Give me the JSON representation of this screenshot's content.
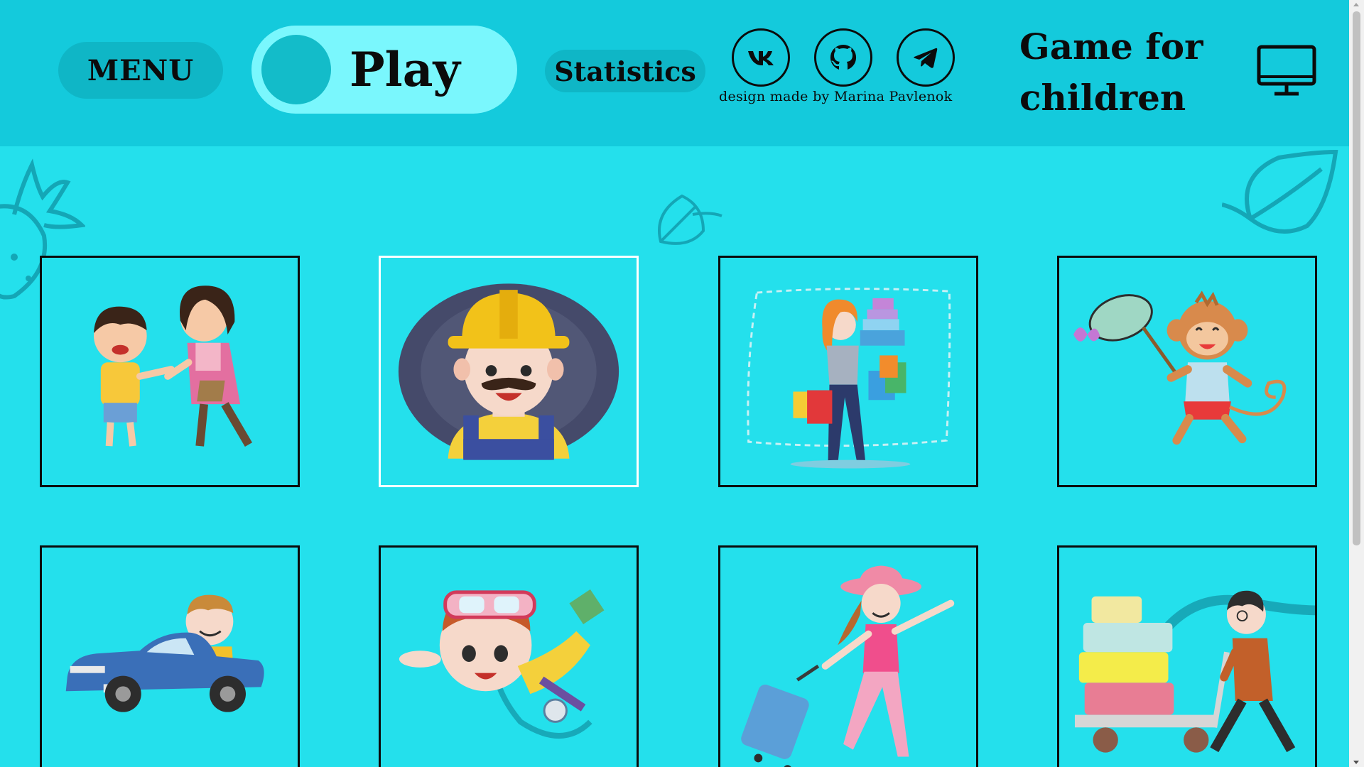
{
  "header": {
    "menu_label": "MENU",
    "play_label": "Play",
    "statistics_label": "Statistics",
    "credit": "design made by Marina Pavlenok",
    "title": "Game for children",
    "social_links": [
      "vk-icon",
      "github-icon",
      "telegram-icon"
    ]
  },
  "colors": {
    "background": "#24e0ec",
    "header": "#14cadc",
    "toggle": "#7af7fd",
    "button": "#0fb6c6",
    "active_border": "#ffffff"
  },
  "cards": [
    {
      "name": "card-quarrel",
      "icon": "arguing-kids-icon"
    },
    {
      "name": "card-builder",
      "icon": "builder-icon",
      "active": true
    },
    {
      "name": "card-shopping",
      "icon": "shopping-woman-icon"
    },
    {
      "name": "card-monkey",
      "icon": "monkey-butterfly-icon"
    },
    {
      "name": "card-driving",
      "icon": "man-driving-car-icon"
    },
    {
      "name": "card-diving",
      "icon": "diver-icon"
    },
    {
      "name": "card-travel",
      "icon": "traveler-woman-icon"
    },
    {
      "name": "card-luggage",
      "icon": "man-luggage-icon"
    }
  ]
}
